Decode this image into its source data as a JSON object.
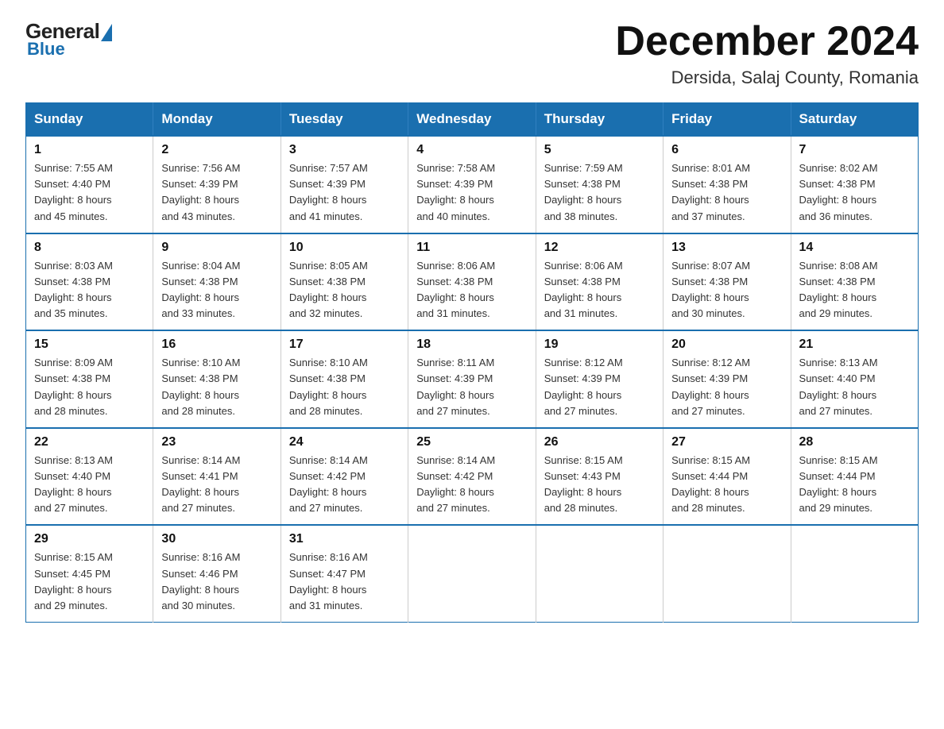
{
  "logo": {
    "general": "General",
    "blue": "Blue"
  },
  "title": "December 2024",
  "location": "Dersida, Salaj County, Romania",
  "days_of_week": [
    "Sunday",
    "Monday",
    "Tuesday",
    "Wednesday",
    "Thursday",
    "Friday",
    "Saturday"
  ],
  "weeks": [
    [
      {
        "day": "1",
        "sunrise": "7:55 AM",
        "sunset": "4:40 PM",
        "daylight": "8 hours and 45 minutes."
      },
      {
        "day": "2",
        "sunrise": "7:56 AM",
        "sunset": "4:39 PM",
        "daylight": "8 hours and 43 minutes."
      },
      {
        "day": "3",
        "sunrise": "7:57 AM",
        "sunset": "4:39 PM",
        "daylight": "8 hours and 41 minutes."
      },
      {
        "day": "4",
        "sunrise": "7:58 AM",
        "sunset": "4:39 PM",
        "daylight": "8 hours and 40 minutes."
      },
      {
        "day": "5",
        "sunrise": "7:59 AM",
        "sunset": "4:38 PM",
        "daylight": "8 hours and 38 minutes."
      },
      {
        "day": "6",
        "sunrise": "8:01 AM",
        "sunset": "4:38 PM",
        "daylight": "8 hours and 37 minutes."
      },
      {
        "day": "7",
        "sunrise": "8:02 AM",
        "sunset": "4:38 PM",
        "daylight": "8 hours and 36 minutes."
      }
    ],
    [
      {
        "day": "8",
        "sunrise": "8:03 AM",
        "sunset": "4:38 PM",
        "daylight": "8 hours and 35 minutes."
      },
      {
        "day": "9",
        "sunrise": "8:04 AM",
        "sunset": "4:38 PM",
        "daylight": "8 hours and 33 minutes."
      },
      {
        "day": "10",
        "sunrise": "8:05 AM",
        "sunset": "4:38 PM",
        "daylight": "8 hours and 32 minutes."
      },
      {
        "day": "11",
        "sunrise": "8:06 AM",
        "sunset": "4:38 PM",
        "daylight": "8 hours and 31 minutes."
      },
      {
        "day": "12",
        "sunrise": "8:06 AM",
        "sunset": "4:38 PM",
        "daylight": "8 hours and 31 minutes."
      },
      {
        "day": "13",
        "sunrise": "8:07 AM",
        "sunset": "4:38 PM",
        "daylight": "8 hours and 30 minutes."
      },
      {
        "day": "14",
        "sunrise": "8:08 AM",
        "sunset": "4:38 PM",
        "daylight": "8 hours and 29 minutes."
      }
    ],
    [
      {
        "day": "15",
        "sunrise": "8:09 AM",
        "sunset": "4:38 PM",
        "daylight": "8 hours and 28 minutes."
      },
      {
        "day": "16",
        "sunrise": "8:10 AM",
        "sunset": "4:38 PM",
        "daylight": "8 hours and 28 minutes."
      },
      {
        "day": "17",
        "sunrise": "8:10 AM",
        "sunset": "4:38 PM",
        "daylight": "8 hours and 28 minutes."
      },
      {
        "day": "18",
        "sunrise": "8:11 AM",
        "sunset": "4:39 PM",
        "daylight": "8 hours and 27 minutes."
      },
      {
        "day": "19",
        "sunrise": "8:12 AM",
        "sunset": "4:39 PM",
        "daylight": "8 hours and 27 minutes."
      },
      {
        "day": "20",
        "sunrise": "8:12 AM",
        "sunset": "4:39 PM",
        "daylight": "8 hours and 27 minutes."
      },
      {
        "day": "21",
        "sunrise": "8:13 AM",
        "sunset": "4:40 PM",
        "daylight": "8 hours and 27 minutes."
      }
    ],
    [
      {
        "day": "22",
        "sunrise": "8:13 AM",
        "sunset": "4:40 PM",
        "daylight": "8 hours and 27 minutes."
      },
      {
        "day": "23",
        "sunrise": "8:14 AM",
        "sunset": "4:41 PM",
        "daylight": "8 hours and 27 minutes."
      },
      {
        "day": "24",
        "sunrise": "8:14 AM",
        "sunset": "4:42 PM",
        "daylight": "8 hours and 27 minutes."
      },
      {
        "day": "25",
        "sunrise": "8:14 AM",
        "sunset": "4:42 PM",
        "daylight": "8 hours and 27 minutes."
      },
      {
        "day": "26",
        "sunrise": "8:15 AM",
        "sunset": "4:43 PM",
        "daylight": "8 hours and 28 minutes."
      },
      {
        "day": "27",
        "sunrise": "8:15 AM",
        "sunset": "4:44 PM",
        "daylight": "8 hours and 28 minutes."
      },
      {
        "day": "28",
        "sunrise": "8:15 AM",
        "sunset": "4:44 PM",
        "daylight": "8 hours and 29 minutes."
      }
    ],
    [
      {
        "day": "29",
        "sunrise": "8:15 AM",
        "sunset": "4:45 PM",
        "daylight": "8 hours and 29 minutes."
      },
      {
        "day": "30",
        "sunrise": "8:16 AM",
        "sunset": "4:46 PM",
        "daylight": "8 hours and 30 minutes."
      },
      {
        "day": "31",
        "sunrise": "8:16 AM",
        "sunset": "4:47 PM",
        "daylight": "8 hours and 31 minutes."
      },
      null,
      null,
      null,
      null
    ]
  ],
  "labels": {
    "sunrise": "Sunrise:",
    "sunset": "Sunset:",
    "daylight": "Daylight:"
  },
  "accent_color": "#1a6faf"
}
